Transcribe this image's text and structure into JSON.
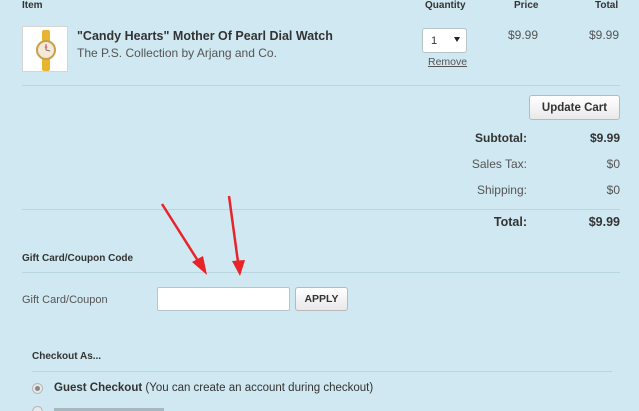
{
  "table": {
    "headers": {
      "item": "Item",
      "quantity": "Quantity",
      "price": "Price",
      "total": "Total"
    }
  },
  "cart_item": {
    "thumbnail_icon": "watch-icon",
    "name": "\"Candy Hearts\" Mother Of Pearl Dial Watch",
    "brand": "The P.S. Collection by Arjang and Co.",
    "quantity": "1",
    "remove_label": "Remove",
    "price": "$9.99",
    "total": "$9.99"
  },
  "update_cart_label": "Update Cart",
  "summary": {
    "subtotal_label": "Subtotal:",
    "subtotal_value": "$9.99",
    "tax_label": "Sales Tax:",
    "tax_value": "$0",
    "shipping_label": "Shipping:",
    "shipping_value": "$0",
    "total_label": "Total:",
    "total_value": "$9.99"
  },
  "coupon": {
    "section_title": "Gift Card/Coupon Code",
    "field_label": "Gift Card/Coupon",
    "input_value": "",
    "apply_label": "APPLY"
  },
  "checkout": {
    "section_title": "Checkout As...",
    "guest_label": "Guest Checkout",
    "guest_note": "(You can create an account during checkout)",
    "guest_selected": true
  },
  "colors": {
    "background": "#cfe8f1",
    "annotation_arrow": "#e8232a"
  }
}
